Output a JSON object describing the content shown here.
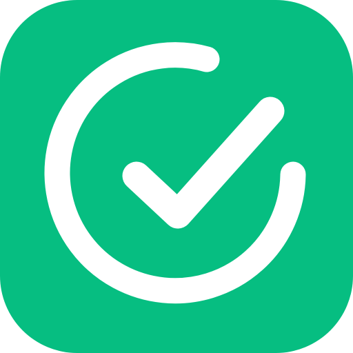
{
  "icon": {
    "name": "check-circle-icon",
    "background_color": "#06BE81",
    "mark_color": "#FFFFFF"
  }
}
